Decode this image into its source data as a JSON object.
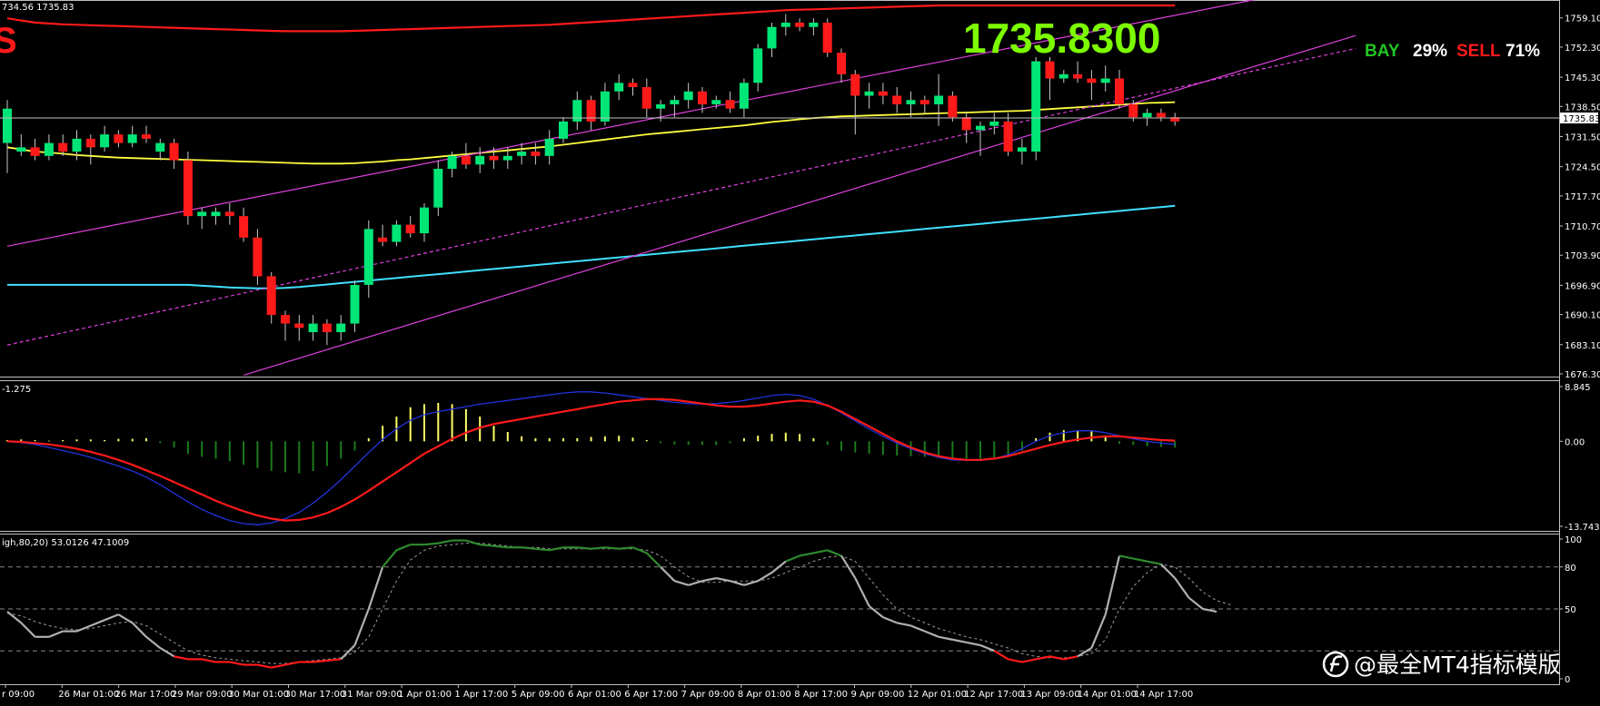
{
  "header": {
    "ohlc_text": "734.56 1735.83",
    "corner_mark": "S",
    "macd_label": "-1.275",
    "stoch_label": "igh,80,20) 53.0126 47.1009"
  },
  "overlay": {
    "big_price": "1735.8300",
    "bay_label": "BAY",
    "bay_pct": "29%",
    "sell_label": "SELL",
    "sell_pct": "71%"
  },
  "watermark": {
    "text": "@最全MT4指标模版"
  },
  "colors": {
    "bull": "#00e676",
    "bear": "#ff1a1a",
    "ma_yellow": "#ffff40",
    "band_red": "#ff1a1a",
    "band_cyan": "#40e0ff",
    "channel": "#e040e0",
    "macd_blue": "#2233dd",
    "macd_red": "#ff1a1a",
    "hist_green": "#1c7a1c",
    "hist_yellow": "#ffff66",
    "stoch_gray": "#b0b0b0",
    "stoch_green": "#2e8b2e",
    "stoch_red": "#ff1a1a"
  },
  "chart_data": [
    {
      "type": "candlestick",
      "symbol_price": 1735.83,
      "ylim": [
        1676.3,
        1762.0
      ],
      "y_ticks": [
        "1759.10",
        "1752.30",
        "1745.30",
        "1738.50",
        "1731.50",
        "1724.50",
        "1717.70",
        "1710.70",
        "1703.90",
        "1696.90",
        "1690.10",
        "1683.10",
        "1676.30"
      ],
      "current_price_label": "1735.83",
      "x_labels": [
        "r 09:00",
        "26 Mar 01:00",
        "26 Mar 17:00",
        "29 Mar 09:00",
        "30 Mar 01:00",
        "30 Mar 17:00",
        "31 Mar 09:00",
        "1 Apr 01:00",
        "1 Apr 17:00",
        "5 Apr 09:00",
        "6 Apr 01:00",
        "6 Apr 17:00",
        "7 Apr 09:00",
        "8 Apr 01:00",
        "8 Apr 17:00",
        "9 Apr 09:00",
        "12 Apr 01:00",
        "12 Apr 17:00",
        "13 Apr 09:00",
        "14 Apr 01:00",
        "14 Apr 17:00"
      ],
      "candles": [
        [
          1730,
          1740,
          1723,
          1738
        ],
        [
          1728,
          1732,
          1727,
          1729
        ],
        [
          1729,
          1731,
          1726,
          1727
        ],
        [
          1727,
          1732,
          1726,
          1730
        ],
        [
          1730,
          1732,
          1727,
          1728
        ],
        [
          1728,
          1733,
          1726,
          1731
        ],
        [
          1731,
          1732,
          1725,
          1729
        ],
        [
          1729,
          1734,
          1728,
          1732
        ],
        [
          1732,
          1733,
          1729,
          1730
        ],
        [
          1730,
          1734,
          1729,
          1732
        ],
        [
          1732,
          1734,
          1730,
          1731
        ],
        [
          1728,
          1731,
          1726,
          1730
        ],
        [
          1730,
          1731,
          1724,
          1726
        ],
        [
          1726,
          1728,
          1711,
          1713
        ],
        [
          1713,
          1715,
          1710,
          1714
        ],
        [
          1713,
          1715,
          1711,
          1714
        ],
        [
          1714,
          1716,
          1711,
          1713
        ],
        [
          1713,
          1715,
          1707,
          1708
        ],
        [
          1708,
          1710,
          1697,
          1699
        ],
        [
          1699,
          1700,
          1688,
          1690
        ],
        [
          1690,
          1691,
          1684,
          1688
        ],
        [
          1688,
          1690,
          1684,
          1687
        ],
        [
          1686,
          1690,
          1684,
          1688
        ],
        [
          1688,
          1689,
          1683,
          1686
        ],
        [
          1686,
          1690,
          1684,
          1688
        ],
        [
          1688,
          1698,
          1686,
          1697
        ],
        [
          1697,
          1712,
          1694,
          1710
        ],
        [
          1708,
          1711,
          1706,
          1707
        ],
        [
          1707,
          1712,
          1706,
          1711
        ],
        [
          1711,
          1713,
          1708,
          1709
        ],
        [
          1709,
          1716,
          1707,
          1715
        ],
        [
          1715,
          1726,
          1713,
          1724
        ],
        [
          1724,
          1728,
          1722,
          1727
        ],
        [
          1727,
          1730,
          1724,
          1725
        ],
        [
          1725,
          1729,
          1723,
          1727
        ],
        [
          1727,
          1729,
          1724,
          1726
        ],
        [
          1726,
          1729,
          1724,
          1727
        ],
        [
          1727,
          1730,
          1725,
          1728
        ],
        [
          1728,
          1730,
          1725,
          1727
        ],
        [
          1727,
          1733,
          1725,
          1731
        ],
        [
          1731,
          1736,
          1730,
          1735
        ],
        [
          1735,
          1742,
          1733,
          1740
        ],
        [
          1740,
          1741,
          1733,
          1735
        ],
        [
          1735,
          1744,
          1734,
          1742
        ],
        [
          1742,
          1746,
          1740,
          1744
        ],
        [
          1744,
          1745,
          1741,
          1743
        ],
        [
          1743,
          1745,
          1736,
          1738
        ],
        [
          1738,
          1740,
          1735,
          1739
        ],
        [
          1739,
          1741,
          1736,
          1740
        ],
        [
          1740,
          1744,
          1738,
          1742
        ],
        [
          1742,
          1743,
          1737,
          1739
        ],
        [
          1739,
          1741,
          1738,
          1740
        ],
        [
          1740,
          1742,
          1737,
          1738
        ],
        [
          1738,
          1745,
          1736,
          1744
        ],
        [
          1744,
          1753,
          1742,
          1752
        ],
        [
          1752,
          1758,
          1750,
          1757
        ],
        [
          1757,
          1760,
          1755,
          1758
        ],
        [
          1758,
          1759,
          1756,
          1757
        ],
        [
          1757,
          1759,
          1755,
          1758
        ],
        [
          1758,
          1759,
          1750,
          1751
        ],
        [
          1751,
          1752,
          1744,
          1746
        ],
        [
          1746,
          1747,
          1732,
          1741
        ],
        [
          1741,
          1744,
          1738,
          1742
        ],
        [
          1742,
          1744,
          1739,
          1741
        ],
        [
          1741,
          1743,
          1737,
          1739
        ],
        [
          1739,
          1742,
          1736,
          1740
        ],
        [
          1740,
          1741,
          1737,
          1739
        ],
        [
          1739,
          1746,
          1734,
          1741
        ],
        [
          1741,
          1742,
          1735,
          1736
        ],
        [
          1736,
          1737,
          1730,
          1733
        ],
        [
          1733,
          1735,
          1727,
          1734
        ],
        [
          1734,
          1737,
          1732,
          1735
        ],
        [
          1735,
          1737,
          1727,
          1728
        ],
        [
          1728,
          1731,
          1725,
          1729
        ],
        [
          1728,
          1750,
          1726,
          1749
        ],
        [
          1749,
          1750,
          1740,
          1745
        ],
        [
          1745,
          1747,
          1744,
          1746
        ],
        [
          1746,
          1749,
          1744,
          1745
        ],
        [
          1745,
          1747,
          1740,
          1744
        ],
        [
          1744,
          1748,
          1742,
          1745
        ],
        [
          1745,
          1747,
          1738,
          1739
        ],
        [
          1739,
          1740,
          1735,
          1736
        ],
        [
          1736,
          1738,
          1734,
          1737
        ],
        [
          1737,
          1738,
          1735,
          1736
        ],
        [
          1736,
          1737,
          1734,
          1735
        ]
      ],
      "ma_yellow": [
        1729,
        1728.5,
        1728,
        1727.8,
        1727.5,
        1727.2,
        1727,
        1726.8,
        1726.6,
        1726.5,
        1726.4,
        1726.3,
        1726.2,
        1726.1,
        1726,
        1725.9,
        1725.8,
        1725.7,
        1725.6,
        1725.5,
        1725.4,
        1725.3,
        1725.2,
        1725.2,
        1725.2,
        1725.3,
        1725.5,
        1725.7,
        1726,
        1726.2,
        1726.5,
        1726.8,
        1727.1,
        1727.4,
        1727.7,
        1728,
        1728.3,
        1728.6,
        1728.9,
        1729.2,
        1729.6,
        1730,
        1730.4,
        1730.8,
        1731.2,
        1731.6,
        1732,
        1732.3,
        1732.6,
        1732.9,
        1733.2,
        1733.5,
        1733.8,
        1734.1,
        1734.5,
        1734.9,
        1735.2,
        1735.5,
        1735.8,
        1736,
        1736.2,
        1736.3,
        1736.4,
        1736.5,
        1736.6,
        1736.7,
        1736.8,
        1736.9,
        1737,
        1737.1,
        1737.2,
        1737.3,
        1737.4,
        1737.5,
        1737.7,
        1737.9,
        1738.1,
        1738.3,
        1738.5,
        1738.7,
        1738.9,
        1739.1,
        1739.3,
        1739.4,
        1739.5
      ],
      "band_upper": [
        1759,
        1758.5,
        1758,
        1757.8,
        1757.6,
        1757.5,
        1757.4,
        1757.3,
        1757.2,
        1757.1,
        1757,
        1756.9,
        1756.8,
        1756.7,
        1756.6,
        1756.5,
        1756.4,
        1756.3,
        1756.2,
        1756.1,
        1756,
        1756,
        1756,
        1756,
        1756,
        1756.1,
        1756.2,
        1756.3,
        1756.4,
        1756.5,
        1756.6,
        1756.7,
        1756.8,
        1756.9,
        1757,
        1757.1,
        1757.2,
        1757.3,
        1757.4,
        1757.5,
        1757.7,
        1757.9,
        1758.1,
        1758.3,
        1758.5,
        1758.7,
        1758.9,
        1759.1,
        1759.3,
        1759.5,
        1759.7,
        1759.9,
        1760.1,
        1760.3,
        1760.5,
        1760.7,
        1760.9,
        1761,
        1761.1,
        1761.2,
        1761.3,
        1761.4,
        1761.5,
        1761.6,
        1761.7,
        1761.8,
        1761.9,
        1762,
        1762,
        1762,
        1762,
        1762,
        1762,
        1762,
        1762,
        1762,
        1762,
        1762,
        1762,
        1762,
        1762,
        1762,
        1762,
        1762,
        1762
      ],
      "band_lower": [
        1697,
        1697,
        1697,
        1697,
        1697,
        1697,
        1697,
        1697,
        1697,
        1697,
        1697,
        1697,
        1697,
        1697,
        1696.8,
        1696.6,
        1696.4,
        1696.3,
        1696.2,
        1696.2,
        1696.3,
        1696.5,
        1696.8,
        1697.1,
        1697.4,
        1697.7,
        1698,
        1698.3,
        1698.6,
        1698.9,
        1699.2,
        1699.5,
        1699.8,
        1700.1,
        1700.4,
        1700.7,
        1701,
        1701.3,
        1701.6,
        1701.9,
        1702.2,
        1702.5,
        1702.8,
        1703.1,
        1703.4,
        1703.7,
        1704,
        1704.3,
        1704.6,
        1704.9,
        1705.2,
        1705.5,
        1705.8,
        1706.1,
        1706.4,
        1706.7,
        1707,
        1707.3,
        1707.6,
        1707.9,
        1708.2,
        1708.5,
        1708.8,
        1709.1,
        1709.4,
        1709.7,
        1710,
        1710.3,
        1710.6,
        1710.9,
        1711.2,
        1711.5,
        1711.8,
        1712.1,
        1712.4,
        1712.7,
        1713,
        1713.3,
        1713.6,
        1713.9,
        1714.2,
        1714.5,
        1714.8,
        1715.1,
        1715.4
      ],
      "channel_lines": [
        {
          "from": [
            0,
            1706
          ],
          "to": [
            97,
            1768
          ]
        },
        {
          "from": [
            0,
            1683
          ],
          "to": [
            97,
            1752
          ]
        },
        {
          "from": [
            17,
            1676
          ],
          "to": [
            97,
            1755
          ]
        }
      ]
    },
    {
      "type": "bar",
      "name": "MACD",
      "y_ticks": [
        "8.845",
        "0.00",
        "-13.743"
      ],
      "ylim": [
        -13.743,
        8.845
      ],
      "histogram": [
        0.2,
        0.3,
        0.2,
        0.1,
        0.2,
        0.3,
        0.3,
        0.2,
        0.4,
        0.4,
        0.5,
        -0.3,
        -1.0,
        -2.0,
        -2.5,
        -2.8,
        -3.2,
        -3.8,
        -4.3,
        -4.8,
        -5.0,
        -5.2,
        -4.8,
        -4.0,
        -2.8,
        -1.5,
        0.5,
        2.5,
        4.0,
        5.5,
        6.0,
        6.2,
        6.0,
        5.2,
        4.0,
        2.5,
        1.5,
        0.8,
        0.5,
        0.5,
        0.5,
        0.5,
        0.7,
        0.8,
        0.9,
        0.6,
        0.2,
        -0.3,
        -0.5,
        -0.6,
        -0.6,
        -0.6,
        -0.3,
        0.5,
        0.9,
        1.2,
        1.4,
        1.2,
        0.5,
        -0.6,
        -1.5,
        -1.8,
        -2.0,
        -2.2,
        -2.3,
        -2.4,
        -2.5,
        -2.6,
        -2.7,
        -2.8,
        -2.8,
        -2.6,
        -2.2,
        -1.5,
        0.5,
        1.4,
        1.8,
        1.8,
        1.6,
        0.9,
        -0.4,
        -0.6,
        -0.8,
        -0.9,
        -1.0
      ],
      "signal": [
        0,
        -0.1,
        -0.3,
        -0.5,
        -0.8,
        -1.2,
        -1.7,
        -2.3,
        -3,
        -3.8,
        -4.7,
        -5.6,
        -6.6,
        -7.6,
        -8.6,
        -9.6,
        -10.5,
        -11.3,
        -12,
        -12.5,
        -12.8,
        -12.7,
        -12.3,
        -11.6,
        -10.6,
        -9.4,
        -8,
        -6.5,
        -5,
        -3.5,
        -2,
        -0.8,
        0.4,
        1.4,
        2.2,
        2.8,
        3.2,
        3.6,
        4,
        4.4,
        4.8,
        5.2,
        5.6,
        6,
        6.4,
        6.6,
        6.8,
        6.8,
        6.7,
        6.4,
        6.1,
        5.8,
        5.6,
        5.6,
        5.8,
        6.1,
        6.4,
        6.6,
        6.4,
        5.8,
        4.8,
        3.6,
        2.4,
        1.2,
        0,
        -1,
        -1.8,
        -2.4,
        -2.8,
        -3,
        -3,
        -2.8,
        -2.4,
        -1.8,
        -1.2,
        -0.6,
        -0.1,
        0.3,
        0.6,
        0.8,
        0.8,
        0.6,
        0.4,
        0.2,
        0.1
      ],
      "macd": [
        0,
        -0.2,
        -0.5,
        -1,
        -1.5,
        -2,
        -2.6,
        -3.3,
        -4,
        -4.8,
        -5.8,
        -7,
        -8.4,
        -9.8,
        -11,
        -12,
        -12.8,
        -13.3,
        -13.5,
        -13.2,
        -12.5,
        -11.5,
        -10,
        -8.2,
        -6.2,
        -4,
        -1.8,
        0.3,
        2,
        3.4,
        4.3,
        4.8,
        5.2,
        5.6,
        6,
        6.3,
        6.6,
        6.9,
        7.2,
        7.5,
        7.8,
        8,
        8,
        7.8,
        7.5,
        7.2,
        6.9,
        6.6,
        6.3,
        6.1,
        6,
        6.1,
        6.3,
        6.6,
        7,
        7.4,
        7.6,
        7.4,
        6.8,
        5.8,
        4.6,
        3.3,
        2,
        0.8,
        -0.3,
        -1.2,
        -2,
        -2.6,
        -3,
        -3.1,
        -3.1,
        -2.8,
        -2.2,
        -1.2,
        0,
        0.9,
        1.4,
        1.7,
        1.7,
        1.4,
        0.9,
        0.4,
        0,
        -0.3,
        -0.5
      ]
    },
    {
      "type": "line",
      "name": "Stochastic",
      "y_ticks": [
        "100",
        "80",
        "50",
        "0"
      ],
      "ylim": [
        0,
        100
      ],
      "levels": [
        80,
        50,
        20
      ],
      "main": [
        48,
        40,
        30,
        30,
        34,
        34,
        38,
        42,
        46,
        40,
        30,
        22,
        16,
        14,
        14,
        12,
        12,
        10,
        10,
        8,
        10,
        12,
        12,
        13,
        14,
        24,
        50,
        80,
        92,
        96,
        96,
        97,
        99,
        99,
        96,
        95,
        94,
        94,
        93,
        92,
        94,
        94,
        93,
        94,
        93,
        94,
        90,
        80,
        70,
        67,
        70,
        72,
        70,
        67,
        70,
        76,
        84,
        88,
        90,
        92,
        88,
        72,
        52,
        44,
        40,
        38,
        34,
        30,
        28,
        26,
        24,
        20,
        14,
        12,
        14,
        16,
        14,
        16,
        22,
        46,
        88,
        86,
        84,
        82,
        72,
        58,
        50,
        48
      ],
      "signal": [
        47,
        45,
        41,
        38,
        36,
        35,
        36,
        38,
        40,
        41,
        38,
        32,
        26,
        20,
        17,
        15,
        14,
        13,
        12,
        11,
        11,
        12,
        13,
        14,
        15,
        19,
        30,
        50,
        70,
        85,
        92,
        95,
        96,
        97,
        97,
        96,
        95,
        94,
        94,
        93,
        93,
        93,
        93,
        93,
        93,
        93,
        92,
        88,
        80,
        73,
        69,
        69,
        70,
        70,
        70,
        72,
        76,
        80,
        84,
        87,
        88,
        84,
        72,
        60,
        50,
        44,
        40,
        36,
        33,
        30,
        28,
        25,
        22,
        18,
        16,
        15,
        15,
        16,
        18,
        28,
        50,
        66,
        76,
        82,
        80,
        72,
        62,
        56,
        53
      ]
    }
  ]
}
